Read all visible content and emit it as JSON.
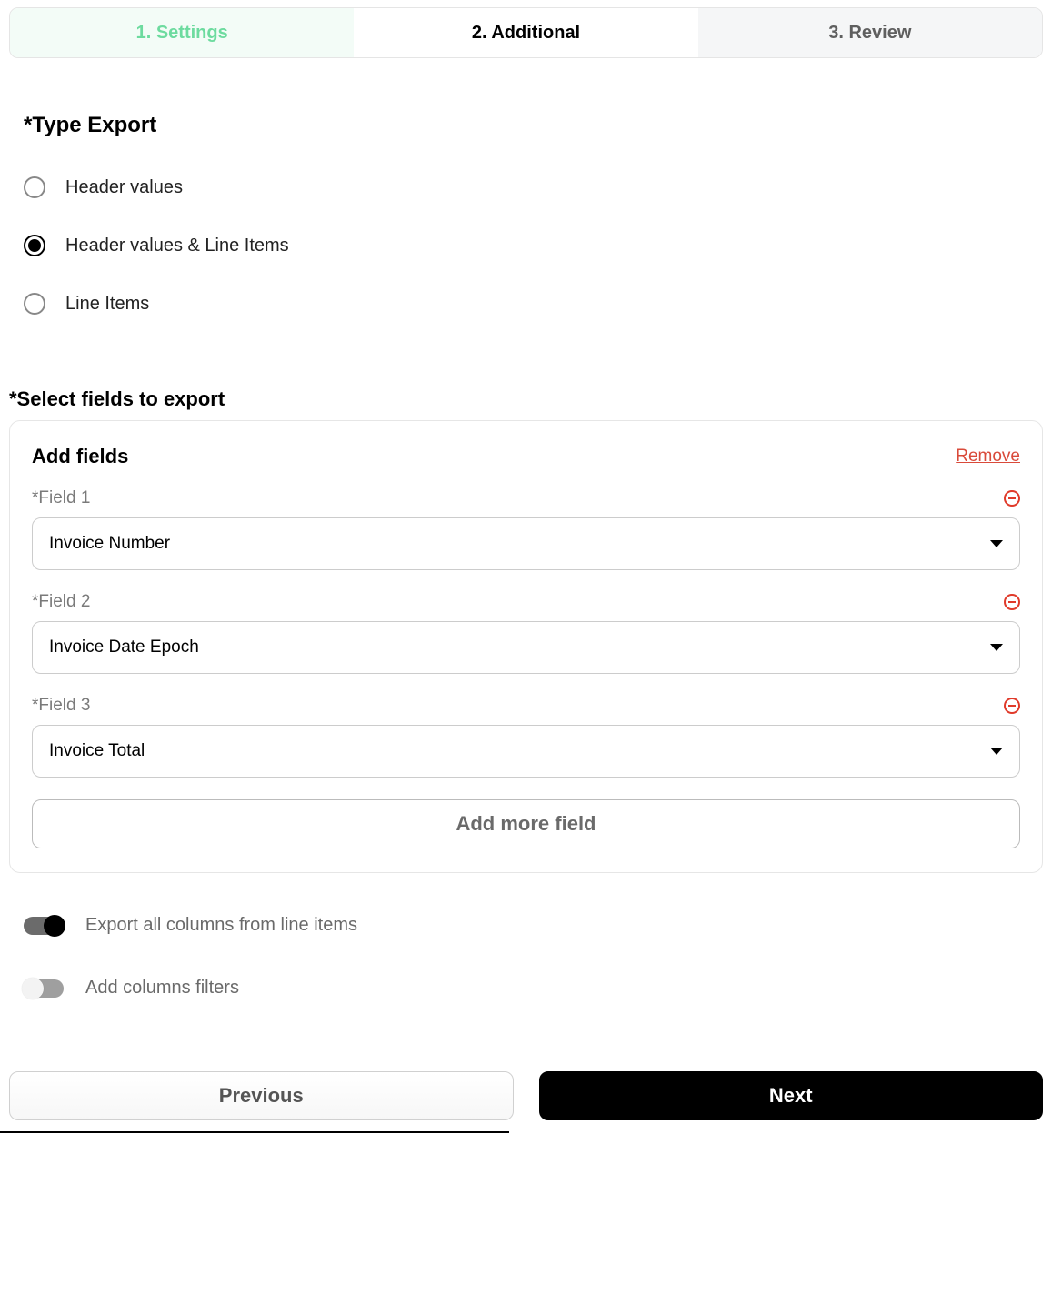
{
  "tabs": {
    "settings": "1. Settings",
    "additional": "2. Additional",
    "review": "3. Review"
  },
  "typeExport": {
    "title": "*Type Export",
    "options": {
      "header": "Header values",
      "headerLine": "Header values & Line Items",
      "line": "Line Items"
    },
    "selected": "headerLine"
  },
  "selectFields": {
    "title": "*Select fields to export",
    "panelTitle": "Add fields",
    "removeAll": "Remove",
    "fields": [
      {
        "label": "*Field 1",
        "value": "Invoice Number"
      },
      {
        "label": "*Field 2",
        "value": "Invoice Date Epoch"
      },
      {
        "label": "*Field 3",
        "value": "Invoice Total"
      }
    ],
    "addMore": "Add more field"
  },
  "toggles": {
    "exportAll": {
      "label": "Export all columns from line items",
      "on": true
    },
    "addFilters": {
      "label": "Add columns filters",
      "on": false
    }
  },
  "footer": {
    "previous": "Previous",
    "next": "Next"
  }
}
